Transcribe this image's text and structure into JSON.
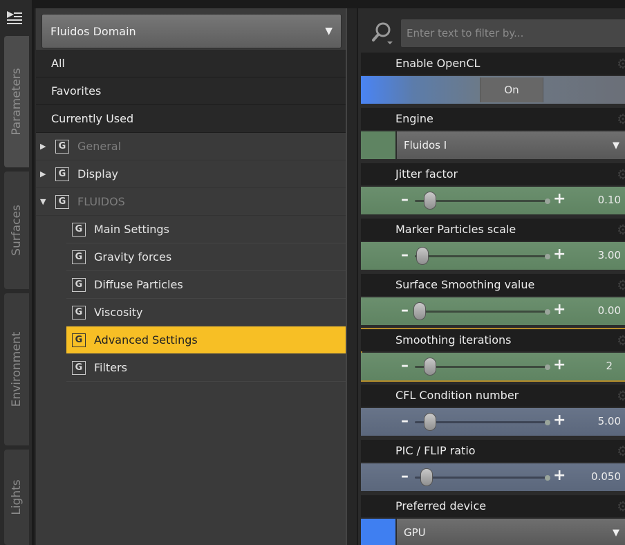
{
  "tabs": [
    {
      "label": "Parameters"
    },
    {
      "label": "Surfaces"
    },
    {
      "label": "Environment"
    },
    {
      "label": "Lights"
    }
  ],
  "tree": {
    "domain_select": "Fluidos Domain",
    "top_items": [
      "All",
      "Favorites",
      "Currently Used"
    ],
    "groups": [
      {
        "label": "General",
        "expanded": false
      },
      {
        "label": "Display",
        "expanded": false
      },
      {
        "label": "FLUIDOS",
        "expanded": true
      }
    ],
    "children": [
      "Main Settings",
      "Gravity forces",
      "Diffuse Particles",
      "Viscosity",
      "Advanced Settings",
      "Filters"
    ],
    "selected": "Advanced Settings",
    "group_icon_letter": "G"
  },
  "filter": {
    "placeholder": "Enter text to filter by..."
  },
  "params": {
    "enable_opencl": {
      "title": "Enable OpenCL",
      "value": "On"
    },
    "engine": {
      "title": "Engine",
      "value": "Fluidos I"
    },
    "jitter": {
      "title": "Jitter factor",
      "value": "0.10",
      "fraction": 0.08
    },
    "marker": {
      "title": "Marker Particles scale",
      "value": "3.00",
      "fraction": 0.02
    },
    "surface_smoothing": {
      "title": "Surface Smoothing value",
      "value": "0.00",
      "fraction": 0.0
    },
    "smoothing_iter": {
      "title": "Smoothing iterations",
      "value": "2",
      "fraction": 0.08
    },
    "cfl": {
      "title": "CFL Condition number",
      "value": "5.00",
      "fraction": 0.08
    },
    "pic_flip": {
      "title": "PIC / FLIP ratio",
      "value": "0.050",
      "fraction": 0.05
    },
    "device": {
      "title": "Preferred device",
      "value": "GPU"
    }
  },
  "colors": {
    "selection": "#f7bf25",
    "green_swatch": "#5f8462",
    "blue_swatch": "#3f7ff1",
    "slider_green": "#6b8f6e",
    "slider_blue": "#687489"
  },
  "icons": [
    "panel-menu-icon",
    "search-icon",
    "gear-icon",
    "dropdown-arrow-icon",
    "expand-arrow-icon",
    "group-icon"
  ]
}
